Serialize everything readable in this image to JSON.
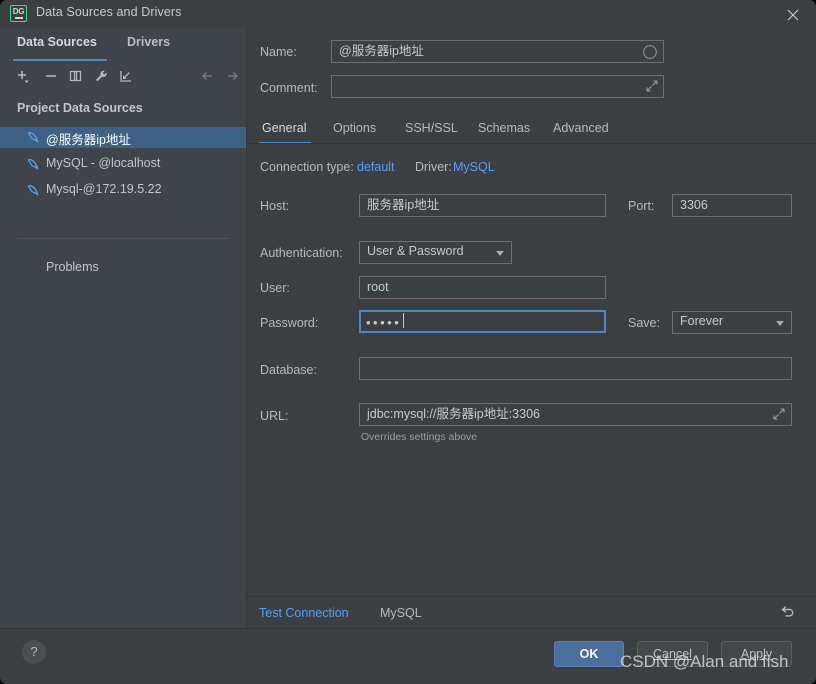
{
  "window": {
    "title": "Data Sources and Drivers",
    "app_icon": "datagrip-icon",
    "close_icon": "close-icon"
  },
  "left_panel": {
    "tabs": [
      {
        "label": "Data Sources",
        "selected": true
      },
      {
        "label": "Drivers",
        "selected": false
      }
    ],
    "toolbar": [
      {
        "name": "add-data-source-button",
        "icon": "plus-icon"
      },
      {
        "name": "remove-data-source-button",
        "icon": "minus-icon"
      },
      {
        "name": "duplicate-data-source-button",
        "icon": "copy-icon"
      },
      {
        "name": "driver-properties-button",
        "icon": "wrench-icon"
      },
      {
        "name": "import-data-sources-button",
        "icon": "import-arrow-icon"
      },
      {
        "name": "navigate-back-button",
        "icon": "arrow-left-icon"
      },
      {
        "name": "navigate-forward-button",
        "icon": "arrow-right-icon"
      }
    ],
    "group_header": "Project Data Sources",
    "data_sources": [
      {
        "label": "@服务器ip地址",
        "selected": true
      },
      {
        "label": "MySQL - @localhost",
        "selected": false
      },
      {
        "label": "Mysql-@172.19.5.22",
        "selected": false
      }
    ],
    "problems_label": "Problems"
  },
  "form": {
    "name_label": "Name:",
    "name_value": "@服务器ip地址",
    "name_icon": "circle-icon",
    "comment_label": "Comment:",
    "comment_value": "",
    "comment_placeholder": "",
    "comment_icon": "expand-icon"
  },
  "tabs": [
    {
      "label": "General",
      "selected": true
    },
    {
      "label": "Options",
      "selected": false
    },
    {
      "label": "SSH/SSL",
      "selected": false
    },
    {
      "label": "Schemas",
      "selected": false
    },
    {
      "label": "Advanced",
      "selected": false
    }
  ],
  "general": {
    "connection_type_label": "Connection type:",
    "connection_type_value": "default",
    "driver_label": "Driver:",
    "driver_value": "MySQL",
    "host_label": "Host:",
    "host_value": "服务器ip地址",
    "port_label": "Port:",
    "port_value": "3306",
    "authentication_label": "Authentication:",
    "authentication_value": "User & Password",
    "user_label": "User:",
    "user_value": "root",
    "password_label": "Password:",
    "password_value": "•••••",
    "save_label": "Save:",
    "save_value": "Forever",
    "database_label": "Database:",
    "database_value": "",
    "url_label": "URL:",
    "url_value": "jdbc:mysql://服务器ip地址:3306",
    "url_icon": "expand-icon",
    "url_hint": "Overrides settings above"
  },
  "bottom_strip": {
    "test_connection_label": "Test Connection",
    "driver_status_label": "MySQL",
    "reset_icon": "revert-icon"
  },
  "footer": {
    "help_label": "?",
    "ok_label": "OK",
    "cancel_label": "Cancel",
    "apply_label": "Apply"
  },
  "watermark": "CSDN @Alan and fish",
  "colors": {
    "window_bg": "#3c3f41",
    "sidebar_bg": "#3f434a",
    "accent_blue": "#4a88c7",
    "link_blue": "#589df6",
    "selection_blue": "#3d6185",
    "ok_button": "#4a6f9e",
    "icon_green": "#3ddb85"
  }
}
